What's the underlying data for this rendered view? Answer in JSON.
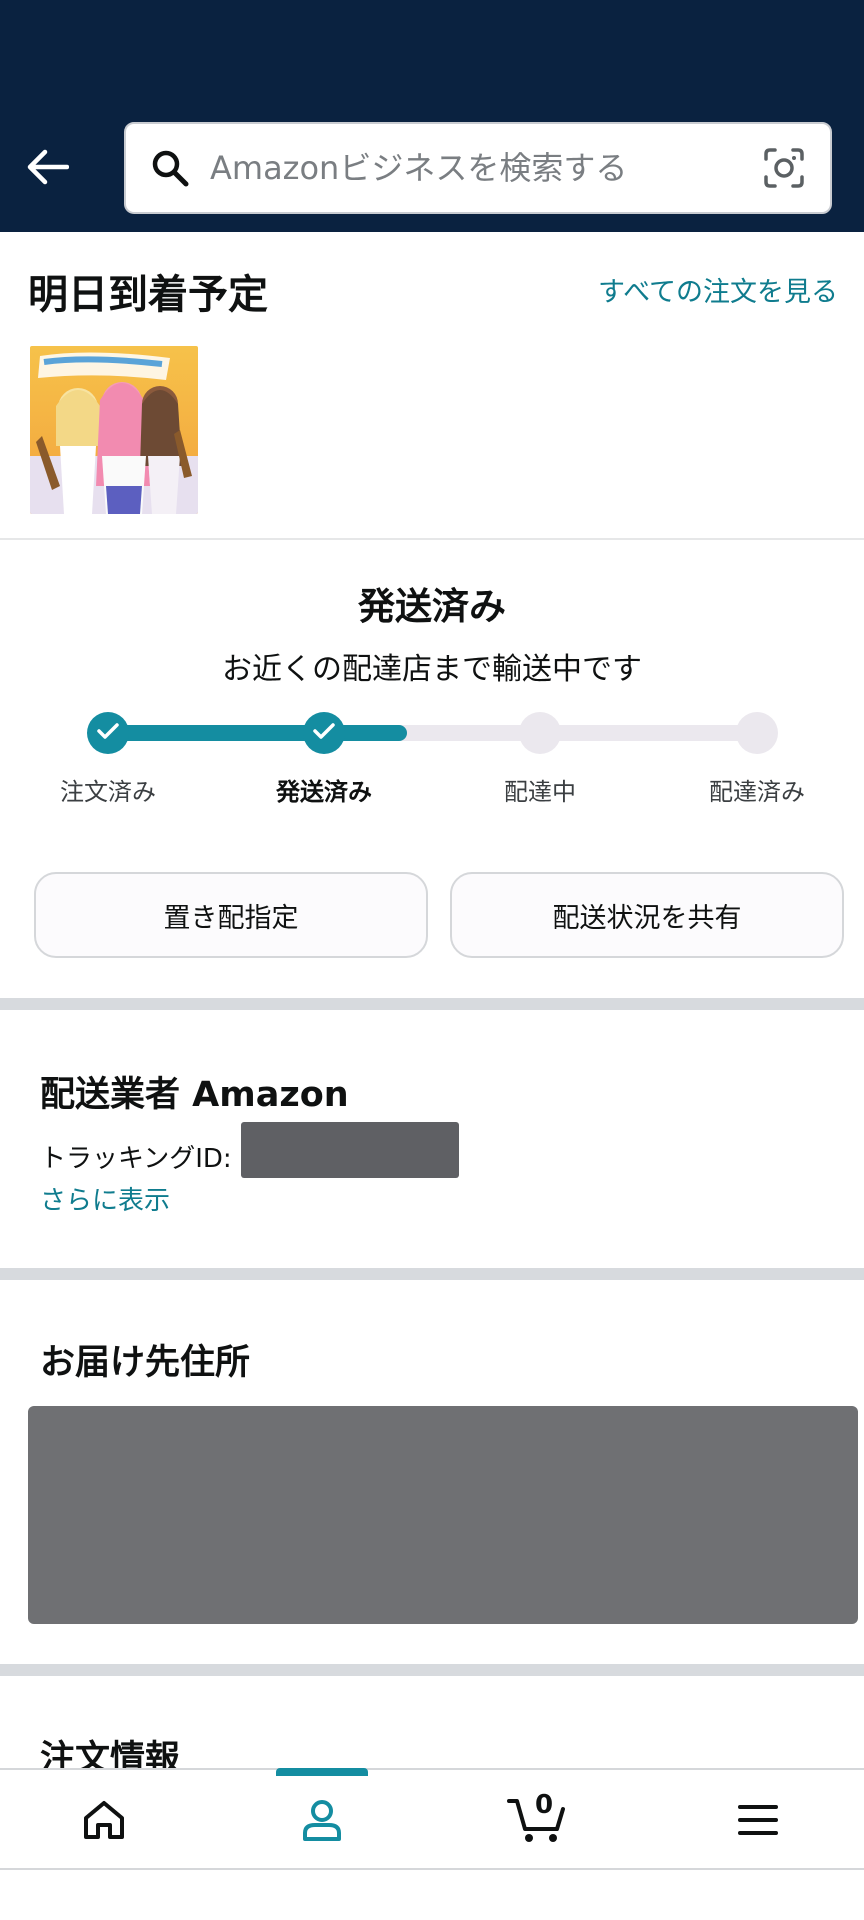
{
  "header": {
    "search_placeholder": "Amazonビジネスを検索する",
    "icons": [
      "back-arrow-icon",
      "search-icon",
      "camera-icon"
    ]
  },
  "arrival": {
    "title": "明日到着予定",
    "all_orders_link": "すべての注文を見る",
    "thumbnail": "product-image"
  },
  "status": {
    "title": "発送済み",
    "subtitle": "お近くの配達店まで輸送中です",
    "progress": 0.46,
    "steps": [
      {
        "label": "注文済み",
        "done": true
      },
      {
        "label": "発送済み",
        "done": true,
        "current": true
      },
      {
        "label": "配達中",
        "done": false
      },
      {
        "label": "配達済み",
        "done": false
      }
    ],
    "buttons": [
      "置き配指定",
      "配送状況を共有"
    ]
  },
  "carrier": {
    "title": "配送業者 Amazon",
    "tracking_label": "トラッキングID:",
    "more_link": "さらに表示"
  },
  "address": {
    "title": "お届け先住所"
  },
  "order_info": {
    "title": "注文情報"
  },
  "bottom_nav": {
    "items": [
      "home-icon",
      "account-icon",
      "cart-icon",
      "menu-icon"
    ],
    "cart_count": "0",
    "active": "account-icon"
  },
  "colors": {
    "header_bg": "#0a2240",
    "accent": "#148da1",
    "link": "#0f7c8e"
  }
}
